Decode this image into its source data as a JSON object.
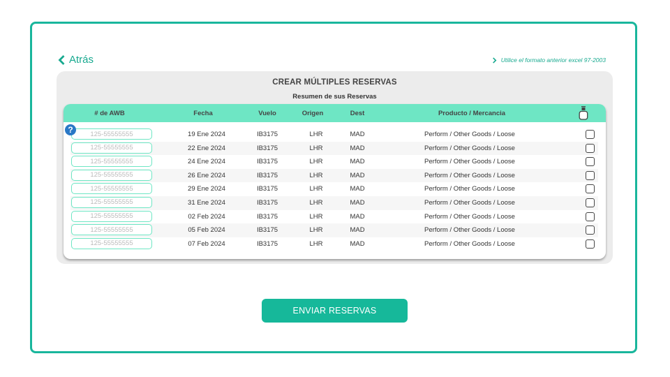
{
  "nav": {
    "back_label": "Atrás",
    "excel_link_label": "Utilice el formato anterior excel 97-2003"
  },
  "panel": {
    "title": "CREAR MÚLTIPLES RESERVAS",
    "subtitle": "Resumen de sus Reservas"
  },
  "table": {
    "columns": [
      "# de AWB",
      "Fecha",
      "Vuelo",
      "Origen",
      "Dest",
      "Producto / Mercancia"
    ],
    "awb_placeholder": "125-55555555",
    "rows": [
      {
        "fecha": "19 Ene 2024",
        "vuelo": "IB3175",
        "origen": "LHR",
        "dest": "MAD",
        "producto": "Perform / Other Goods / Loose",
        "checked": false
      },
      {
        "fecha": "22 Ene 2024",
        "vuelo": "IB3175",
        "origen": "LHR",
        "dest": "MAD",
        "producto": "Perform / Other Goods / Loose",
        "checked": false
      },
      {
        "fecha": "24 Ene 2024",
        "vuelo": "IB3175",
        "origen": "LHR",
        "dest": "MAD",
        "producto": "Perform / Other Goods / Loose",
        "checked": false
      },
      {
        "fecha": "26 Ene 2024",
        "vuelo": "IB3175",
        "origen": "LHR",
        "dest": "MAD",
        "producto": "Perform / Other Goods / Loose",
        "checked": false
      },
      {
        "fecha": "29 Ene 2024",
        "vuelo": "IB3175",
        "origen": "LHR",
        "dest": "MAD",
        "producto": "Perform / Other Goods / Loose",
        "checked": false
      },
      {
        "fecha": "31 Ene 2024",
        "vuelo": "IB3175",
        "origen": "LHR",
        "dest": "MAD",
        "producto": "Perform / Other Goods / Loose",
        "checked": false
      },
      {
        "fecha": "02 Feb 2024",
        "vuelo": "IB3175",
        "origen": "LHR",
        "dest": "MAD",
        "producto": "Perform / Other Goods / Loose",
        "checked": false
      },
      {
        "fecha": "05 Feb 2024",
        "vuelo": "IB3175",
        "origen": "LHR",
        "dest": "MAD",
        "producto": "Perform / Other Goods / Loose",
        "checked": false
      },
      {
        "fecha": "07 Feb 2024",
        "vuelo": "IB3175",
        "origen": "LHR",
        "dest": "MAD",
        "producto": "Perform / Other Goods / Loose",
        "checked": false
      }
    ]
  },
  "help_icon": "?",
  "actions": {
    "send_label": "ENVIAR RESERVAS"
  },
  "colors": {
    "accent": "#16b89a",
    "header": "#6ee6c4",
    "help": "#2a78c6"
  }
}
